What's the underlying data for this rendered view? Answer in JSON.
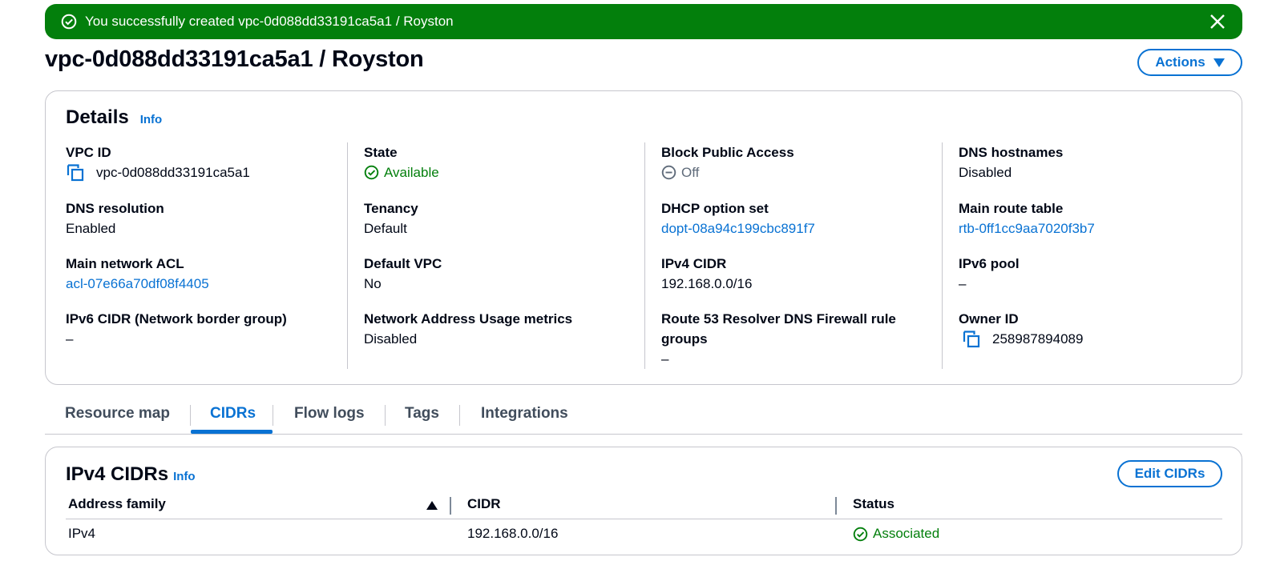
{
  "flash": {
    "message": "You successfully created vpc-0d088dd33191ca5a1 / Royston",
    "color": "#037f0c"
  },
  "page": {
    "title": "vpc-0d088dd33191ca5a1 / Royston",
    "actions_label": "Actions"
  },
  "details": {
    "heading": "Details",
    "info_label": "Info",
    "columns": [
      [
        {
          "label": "VPC ID",
          "value": "vpc-0d088dd33191ca5a1"
        },
        {
          "label": "DNS resolution",
          "value": "Enabled"
        },
        {
          "label": "Main network ACL",
          "value": "acl-07e66a70df08f4405"
        },
        {
          "label": "IPv6 CIDR (Network border group)",
          "value": "–"
        }
      ],
      [
        {
          "label": "State",
          "value": "Available"
        },
        {
          "label": "Tenancy",
          "value": "Default"
        },
        {
          "label": "Default VPC",
          "value": "No"
        },
        {
          "label": "Network Address Usage metrics",
          "value": "Disabled"
        }
      ],
      [
        {
          "label": "Block Public Access",
          "value": "Off"
        },
        {
          "label": "DHCP option set",
          "value": "dopt-08a94c199cbc891f7"
        },
        {
          "label": "IPv4 CIDR",
          "value": "192.168.0.0/16"
        },
        {
          "label": "Route 53 Resolver DNS Firewall rule groups",
          "value": "–"
        }
      ],
      [
        {
          "label": "DNS hostnames",
          "value": "Disabled"
        },
        {
          "label": "Main route table",
          "value": "rtb-0ff1cc9aa7020f3b7"
        },
        {
          "label": "IPv6 pool",
          "value": "–"
        },
        {
          "label": "Owner ID",
          "value": "258987894089"
        }
      ]
    ]
  },
  "tabs": [
    {
      "label": "Resource map"
    },
    {
      "label": "CIDRs",
      "active": true
    },
    {
      "label": "Flow logs"
    },
    {
      "label": "Tags"
    },
    {
      "label": "Integrations"
    }
  ],
  "ipv4_cidrs": {
    "heading": "IPv4 CIDRs",
    "info_label": "Info",
    "edit_label": "Edit CIDRs",
    "columns": [
      "Address family",
      "CIDR",
      "Status"
    ],
    "rows": [
      {
        "address_family": "IPv4",
        "cidr": "192.168.0.0/16",
        "status": "Associated"
      }
    ]
  },
  "colors": {
    "accent": "#0972d3",
    "success": "#037f0c",
    "border": "#c6c6cd"
  },
  "icons": {
    "copy": "copy-icon",
    "success": "check-circle-icon",
    "off": "minus-circle-icon",
    "close": "close-icon",
    "caret": "caret-down-icon",
    "sort": "sort-ascending-icon"
  }
}
